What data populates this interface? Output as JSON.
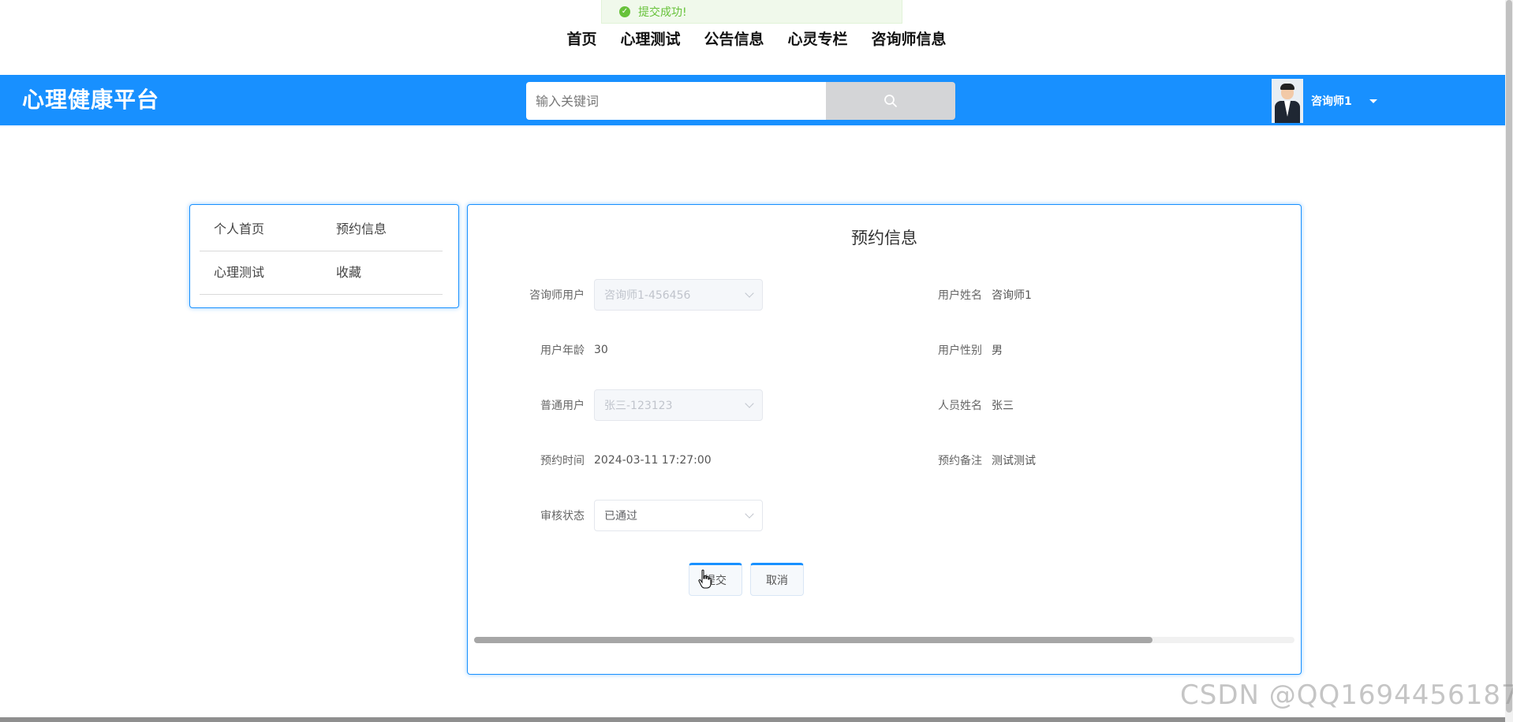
{
  "toast": {
    "message": "提交成功!"
  },
  "top_nav": [
    "首页",
    "心理测试",
    "公告信息",
    "心灵专栏",
    "咨询师信息"
  ],
  "header": {
    "brand": "心理健康平台",
    "search_placeholder": "输入关键词",
    "user_name": "咨询师1",
    "colors": {
      "brand_blue": "#1890ff"
    }
  },
  "sidebar": {
    "items": [
      {
        "label": "个人首页"
      },
      {
        "label": "预约信息"
      },
      {
        "label": "心理测试"
      },
      {
        "label": "收藏"
      }
    ]
  },
  "form": {
    "title": "预约信息",
    "fields": {
      "counselor_user": {
        "label": "咨询师用户",
        "value": "咨询师1-456456"
      },
      "user_name": {
        "label": "用户姓名",
        "value": "咨询师1"
      },
      "user_age": {
        "label": "用户年龄",
        "value": "30"
      },
      "user_gender": {
        "label": "用户性别",
        "value": "男"
      },
      "normal_user": {
        "label": "普通用户",
        "value": "张三-123123"
      },
      "person_name": {
        "label": "人员姓名",
        "value": "张三"
      },
      "appointment_time": {
        "label": "预约时间",
        "value": "2024-03-11 17:27:00"
      },
      "appointment_note": {
        "label": "预约备注",
        "value": "测试测试"
      },
      "review_status": {
        "label": "审核状态",
        "value": "已通过"
      }
    },
    "submit_label": "提交",
    "cancel_label": "取消"
  },
  "watermark": "CSDN @QQ1694456187"
}
